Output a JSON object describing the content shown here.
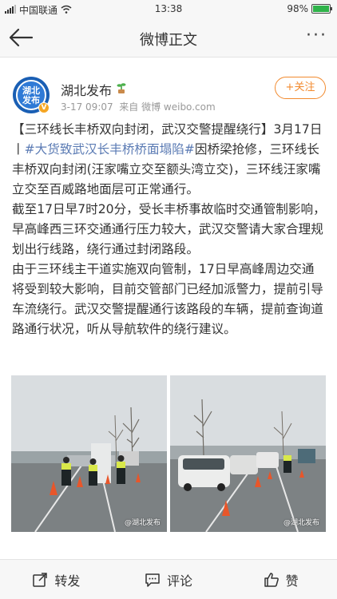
{
  "status": {
    "carrier": "中国联通",
    "time": "13:38",
    "battery": "98%",
    "battery_level": 0.98
  },
  "nav": {
    "title": "微博正文"
  },
  "post": {
    "author": "湖北发布",
    "avatar_text": "湖北\n发布",
    "time": "3-17 09:07",
    "source": "来自 微博 weibo.com",
    "follow_label": "+关注",
    "text_intro": "【三环线长丰桥双向封闭，武汉交警提醒绕行】3月17日丨",
    "topic": "#大货致武汉长丰桥桥面塌陷#",
    "text_after_topic": "因桥梁抢修，三环线长丰桥双向封闭(汪家嘴立交至额头湾立交)，三环线汪家嘴立交至百威路地面层可正常通行。",
    "paragraph_2": "截至17日早7时20分，受长丰桥事故临时交通管制影响，早高峰西三环交通通行压力较大，武汉交警请大家合理规划出行线路，绕行通过封闭路段。",
    "paragraph_3": "由于三环线主干道实施双向管制，17日早高峰周边交通将受到较大影响，目前交管部门已经加派警力，提前引导车流绕行。武汉交警提醒通行该路段的车辆，提前查询道路通行状况，听从导航软件的绕行建议。",
    "watermark_1": "@湖北发布",
    "watermark_2": "@湖北发布"
  },
  "actions": {
    "repost": "转发",
    "comment": "评论",
    "like": "赞"
  },
  "colors": {
    "accent_orange": "#f28a2e",
    "topic_blue": "#5b7bb4",
    "avatar_blue": "#1a5fb4"
  }
}
